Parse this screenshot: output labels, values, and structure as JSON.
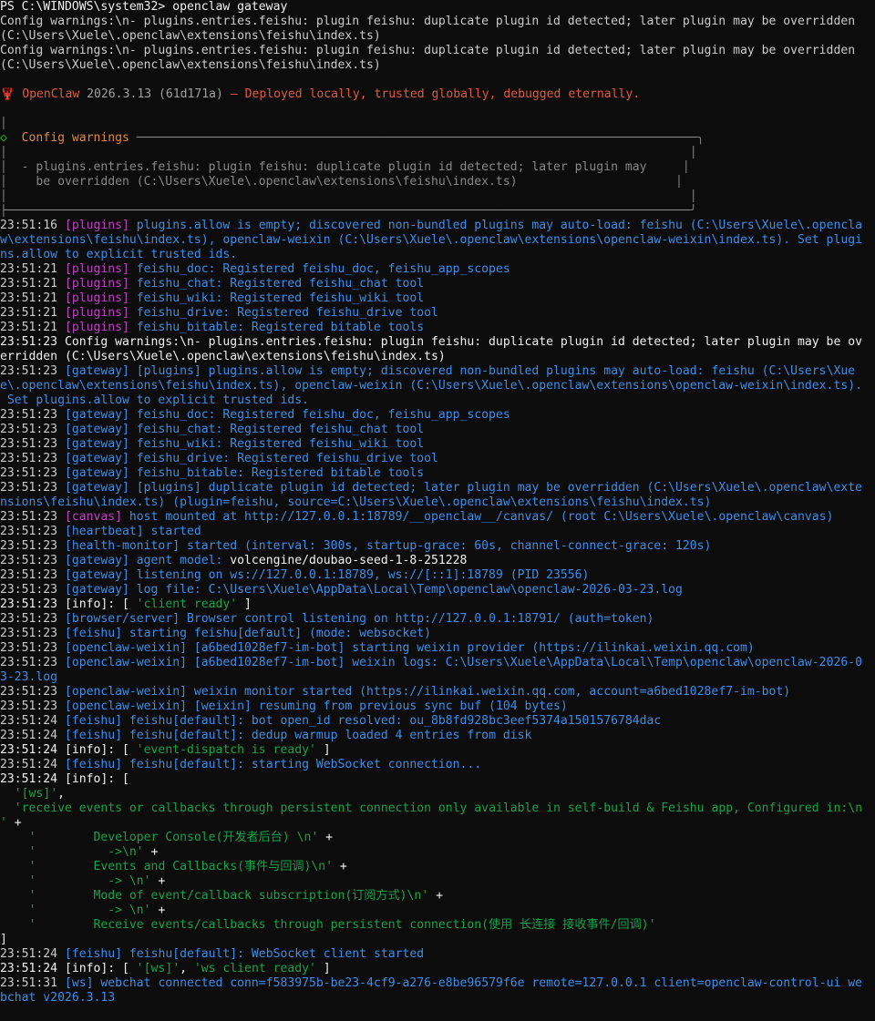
{
  "prompt": {
    "ps": "PS C:\\WINDOWS\\system32> ",
    "command": "openclaw gateway"
  },
  "lines": [
    {
      "segs": [
        {
          "t": "Config warnings:\\n- plugins.entries.feishu: plugin feishu: duplicate plugin id detected; later plugin may be overridden",
          "c": "w"
        }
      ]
    },
    {
      "segs": [
        {
          "t": "(C:\\Users\\Xuele\\.openclaw\\extensions\\feishu\\index.ts)",
          "c": "w"
        }
      ]
    },
    {
      "segs": [
        {
          "t": "Config warnings:\\n- plugins.entries.feishu: plugin feishu: duplicate plugin id detected; later plugin may be overridden",
          "c": "w"
        }
      ]
    },
    {
      "segs": [
        {
          "t": "(C:\\Users\\Xuele\\.openclaw\\extensions\\feishu\\index.ts)",
          "c": "w"
        }
      ]
    },
    {
      "segs": [
        {
          "t": "",
          "c": "w"
        }
      ]
    },
    {
      "segs": [
        {
          "t": "🦞 ",
          "c": "banner-name"
        },
        {
          "t": "OpenClaw",
          "c": "banner-name"
        },
        {
          "t": " 2026.3.13 (61d171a)",
          "c": "banner-ver"
        },
        {
          "t": " — Deployed locally, trusted globally, debugged eternally.",
          "c": "banner-tag"
        }
      ]
    },
    {
      "segs": [
        {
          "t": "",
          "c": "w"
        }
      ]
    },
    {
      "segs": [
        {
          "t": "│",
          "c": "box"
        }
      ]
    },
    {
      "segs": [
        {
          "t": "◇  ",
          "c": "gr"
        },
        {
          "t": "Config warnings",
          "c": "warnhead"
        },
        {
          "t": " ──────────────────────────────────────────────────────────────────────────────╮",
          "c": "box"
        }
      ]
    },
    {
      "segs": [
        {
          "t": "│                                                                                               │",
          "c": "box"
        }
      ]
    },
    {
      "segs": [
        {
          "t": "│  - plugins.entries.feishu: plugin feishu: duplicate plugin id detected; later plugin may     │",
          "c": "box"
        }
      ]
    },
    {
      "segs": [
        {
          "t": "│    be overridden (C:\\Users\\Xuele\\.openclaw\\extensions\\feishu\\index.ts)                      │",
          "c": "box"
        }
      ]
    },
    {
      "segs": [
        {
          "t": "│                                                                                               │",
          "c": "box"
        }
      ]
    },
    {
      "segs": [
        {
          "t": "├───────────────────────────────────────────────────────────────────────────────────────────────╯",
          "c": "box"
        }
      ]
    },
    {
      "segs": [
        {
          "t": "23:51:16 ",
          "c": "ts"
        },
        {
          "t": "[plugins]",
          "c": "tag-pl"
        },
        {
          "t": " plugins.allow is empty; discovered non-bundled plugins may auto-load: feishu (C:\\Users\\Xuele\\.opencla",
          "c": "msg-dim"
        }
      ]
    },
    {
      "segs": [
        {
          "t": "w\\extensions\\feishu\\index.ts), openclaw-weixin (C:\\Users\\Xuele\\.openclaw\\extensions\\openclaw-weixin\\index.ts). Set plugi",
          "c": "msg-dim"
        }
      ]
    },
    {
      "segs": [
        {
          "t": "ns.allow to explicit trusted ids.",
          "c": "msg-dim"
        }
      ]
    },
    {
      "segs": [
        {
          "t": "23:51:21 ",
          "c": "ts"
        },
        {
          "t": "[plugins]",
          "c": "tag-pl"
        },
        {
          "t": " feishu_doc: Registered feishu_doc, feishu_app_scopes",
          "c": "msg-dim"
        }
      ]
    },
    {
      "segs": [
        {
          "t": "23:51:21 ",
          "c": "ts"
        },
        {
          "t": "[plugins]",
          "c": "tag-pl"
        },
        {
          "t": " feishu_chat: Registered feishu_chat tool",
          "c": "msg-dim"
        }
      ]
    },
    {
      "segs": [
        {
          "t": "23:51:21 ",
          "c": "ts"
        },
        {
          "t": "[plugins]",
          "c": "tag-pl"
        },
        {
          "t": " feishu_wiki: Registered feishu_wiki tool",
          "c": "msg-dim"
        }
      ]
    },
    {
      "segs": [
        {
          "t": "23:51:21 ",
          "c": "ts"
        },
        {
          "t": "[plugins]",
          "c": "tag-pl"
        },
        {
          "t": " feishu_drive: Registered feishu_drive tool",
          "c": "msg-dim"
        }
      ]
    },
    {
      "segs": [
        {
          "t": "23:51:21 ",
          "c": "ts"
        },
        {
          "t": "[plugins]",
          "c": "tag-pl"
        },
        {
          "t": " feishu_bitable: Registered bitable tools",
          "c": "msg-dim"
        }
      ]
    },
    {
      "segs": [
        {
          "t": "23:51:23 Config warnings:\\n- plugins.entries.feishu: plugin feishu: duplicate plugin id detected; later plugin may be ov",
          "c": "bw"
        }
      ]
    },
    {
      "segs": [
        {
          "t": "erridden (C:\\Users\\Xuele\\.openclaw\\extensions\\feishu\\index.ts)",
          "c": "bw"
        }
      ]
    },
    {
      "segs": [
        {
          "t": "23:51:23 ",
          "c": "ts"
        },
        {
          "t": "[gateway]",
          "c": "tag-gw"
        },
        {
          "t": " [plugins] plugins.allow is empty; discovered non-bundled plugins may auto-load: feishu (C:\\Users\\Xue",
          "c": "msg-dim"
        }
      ]
    },
    {
      "segs": [
        {
          "t": "e\\.openclaw\\extensions\\feishu\\index.ts), openclaw-weixin (C:\\Users\\Xuele\\.openclaw\\extensions\\openclaw-weixin\\index.ts).",
          "c": "msg-dim"
        }
      ]
    },
    {
      "segs": [
        {
          "t": " Set plugins.allow to explicit trusted ids.",
          "c": "msg-dim"
        }
      ]
    },
    {
      "segs": [
        {
          "t": "23:51:23 ",
          "c": "ts"
        },
        {
          "t": "[gateway]",
          "c": "tag-gw"
        },
        {
          "t": " feishu_doc: Registered feishu_doc, feishu_app_scopes",
          "c": "msg-dim"
        }
      ]
    },
    {
      "segs": [
        {
          "t": "23:51:23 ",
          "c": "ts"
        },
        {
          "t": "[gateway]",
          "c": "tag-gw"
        },
        {
          "t": " feishu_chat: Registered feishu_chat tool",
          "c": "msg-dim"
        }
      ]
    },
    {
      "segs": [
        {
          "t": "23:51:23 ",
          "c": "ts"
        },
        {
          "t": "[gateway]",
          "c": "tag-gw"
        },
        {
          "t": " feishu_wiki: Registered feishu_wiki tool",
          "c": "msg-dim"
        }
      ]
    },
    {
      "segs": [
        {
          "t": "23:51:23 ",
          "c": "ts"
        },
        {
          "t": "[gateway]",
          "c": "tag-gw"
        },
        {
          "t": " feishu_drive: Registered feishu_drive tool",
          "c": "msg-dim"
        }
      ]
    },
    {
      "segs": [
        {
          "t": "23:51:23 ",
          "c": "ts"
        },
        {
          "t": "[gateway]",
          "c": "tag-gw"
        },
        {
          "t": " feishu_bitable: Registered bitable tools",
          "c": "msg-dim"
        }
      ]
    },
    {
      "segs": [
        {
          "t": "23:51:23 ",
          "c": "ts"
        },
        {
          "t": "[gateway]",
          "c": "tag-gw"
        },
        {
          "t": " [plugins] duplicate plugin id detected; later plugin may be overridden (C:\\Users\\Xuele\\.openclaw\\exte",
          "c": "msg-dim"
        }
      ]
    },
    {
      "segs": [
        {
          "t": "nsions\\feishu\\index.ts) (plugin=feishu, source=C:\\Users\\Xuele\\.openclaw\\extensions\\feishu\\index.ts)",
          "c": "msg-dim"
        }
      ]
    },
    {
      "segs": [
        {
          "t": "23:51:23 ",
          "c": "ts"
        },
        {
          "t": "[canvas]",
          "c": "tag-cv"
        },
        {
          "t": " host mounted at http://127.0.0.1:18789/__openclaw__/canvas/ (root C:\\Users\\Xuele\\.openclaw\\canvas)",
          "c": "msg-dim"
        }
      ]
    },
    {
      "segs": [
        {
          "t": "23:51:23 ",
          "c": "ts"
        },
        {
          "t": "[heartbeat]",
          "c": "tag-hb"
        },
        {
          "t": " started",
          "c": "msg-dim"
        }
      ]
    },
    {
      "segs": [
        {
          "t": "23:51:23 ",
          "c": "ts"
        },
        {
          "t": "[health-monitor]",
          "c": "tag-hm"
        },
        {
          "t": " started (interval: 300s, startup-grace: 60s, channel-connect-grace: 120s)",
          "c": "msg-dim"
        }
      ]
    },
    {
      "segs": [
        {
          "t": "23:51:23 ",
          "c": "ts"
        },
        {
          "t": "[gateway]",
          "c": "tag-gw"
        },
        {
          "t": " agent model: ",
          "c": "msg-dim"
        },
        {
          "t": "volcengine/doubao-seed-1-8-251228",
          "c": "bw"
        }
      ]
    },
    {
      "segs": [
        {
          "t": "23:51:23 ",
          "c": "ts"
        },
        {
          "t": "[gateway]",
          "c": "tag-gw"
        },
        {
          "t": " listening on ws://127.0.0.1:18789, ws://[::1]:18789 (PID 23556)",
          "c": "msg-dim"
        }
      ]
    },
    {
      "segs": [
        {
          "t": "23:51:23 ",
          "c": "ts"
        },
        {
          "t": "[gateway]",
          "c": "tag-gw"
        },
        {
          "t": " log file: C:\\Users\\Xuele\\AppData\\Local\\Temp\\openclaw\\openclaw-2026-03-23.log",
          "c": "msg-dim"
        }
      ]
    },
    {
      "segs": [
        {
          "t": "23:51:23 [info]: [ ",
          "c": "bw"
        },
        {
          "t": "'client ready'",
          "c": "str"
        },
        {
          "t": " ]",
          "c": "bw"
        }
      ]
    },
    {
      "segs": [
        {
          "t": "23:51:23 ",
          "c": "ts"
        },
        {
          "t": "[browser/server]",
          "c": "tag-bs"
        },
        {
          "t": " Browser control listening on http://127.0.0.1:18791/ (auth=token)",
          "c": "msg-dim"
        }
      ]
    },
    {
      "segs": [
        {
          "t": "23:51:23 ",
          "c": "ts"
        },
        {
          "t": "[feishu]",
          "c": "tag-fs"
        },
        {
          "t": " starting feishu[default] (mode: websocket)",
          "c": "msg-dim"
        }
      ]
    },
    {
      "segs": [
        {
          "t": "23:51:23 ",
          "c": "ts"
        },
        {
          "t": "[openclaw-weixin]",
          "c": "tag-ow"
        },
        {
          "t": " [a6bed1028ef7-im-bot] starting weixin provider (https://ilinkai.weixin.qq.com)",
          "c": "msg-dim"
        }
      ]
    },
    {
      "segs": [
        {
          "t": "23:51:23 ",
          "c": "ts"
        },
        {
          "t": "[openclaw-weixin]",
          "c": "tag-ow"
        },
        {
          "t": " [a6bed1028ef7-im-bot] weixin logs: C:\\Users\\Xuele\\AppData\\Local\\Temp\\openclaw\\openclaw-2026-0",
          "c": "msg-dim"
        }
      ]
    },
    {
      "segs": [
        {
          "t": "3-23.log",
          "c": "msg-dim"
        }
      ]
    },
    {
      "segs": [
        {
          "t": "23:51:23 ",
          "c": "ts"
        },
        {
          "t": "[openclaw-weixin]",
          "c": "tag-ow"
        },
        {
          "t": " weixin monitor started (https://ilinkai.weixin.qq.com, account=a6bed1028ef7-im-bot)",
          "c": "msg-dim"
        }
      ]
    },
    {
      "segs": [
        {
          "t": "23:51:23 ",
          "c": "ts"
        },
        {
          "t": "[openclaw-weixin]",
          "c": "tag-ow"
        },
        {
          "t": " [weixin] resuming from previous sync buf (104 bytes)",
          "c": "msg-dim"
        }
      ]
    },
    {
      "segs": [
        {
          "t": "23:51:24 ",
          "c": "ts"
        },
        {
          "t": "[feishu]",
          "c": "tag-fs"
        },
        {
          "t": " feishu[default]: bot open_id resolved: ou_8b8fd928bc3eef5374a1501576784dac",
          "c": "msg-dim"
        }
      ]
    },
    {
      "segs": [
        {
          "t": "23:51:24 ",
          "c": "ts"
        },
        {
          "t": "[feishu]",
          "c": "tag-fs"
        },
        {
          "t": " feishu[default]: dedup warmup loaded 4 entries from disk",
          "c": "msg-dim"
        }
      ]
    },
    {
      "segs": [
        {
          "t": "23:51:24 [info]: [ ",
          "c": "bw"
        },
        {
          "t": "'event-dispatch is ready'",
          "c": "str"
        },
        {
          "t": " ]",
          "c": "bw"
        }
      ]
    },
    {
      "segs": [
        {
          "t": "23:51:24 ",
          "c": "ts"
        },
        {
          "t": "[feishu]",
          "c": "tag-fs"
        },
        {
          "t": " feishu[default]: starting WebSocket connection...",
          "c": "msg-dim"
        }
      ]
    },
    {
      "segs": [
        {
          "t": "23:51:24 [info]: [",
          "c": "bw"
        }
      ]
    },
    {
      "segs": [
        {
          "t": "  ",
          "c": "bw"
        },
        {
          "t": "'[ws]'",
          "c": "str"
        },
        {
          "t": ",",
          "c": "bw"
        }
      ]
    },
    {
      "segs": [
        {
          "t": "  ",
          "c": "bw"
        },
        {
          "t": "'receive events or callbacks through persistent connection only available in self-build & Feishu app, Configured in:\\n",
          "c": "str"
        }
      ]
    },
    {
      "segs": [
        {
          "t": "' ",
          "c": "str"
        },
        {
          "t": "+",
          "c": "bw"
        }
      ]
    },
    {
      "segs": [
        {
          "t": "    ",
          "c": "bw"
        },
        {
          "t": "'        Developer Console(开发者后台) \\n'",
          "c": "str"
        },
        {
          "t": " +",
          "c": "bw"
        }
      ]
    },
    {
      "segs": [
        {
          "t": "    ",
          "c": "bw"
        },
        {
          "t": "'          ->\\n'",
          "c": "str"
        },
        {
          "t": " +",
          "c": "bw"
        }
      ]
    },
    {
      "segs": [
        {
          "t": "    ",
          "c": "bw"
        },
        {
          "t": "'        Events and Callbacks(事件与回调)\\n'",
          "c": "str"
        },
        {
          "t": " +",
          "c": "bw"
        }
      ]
    },
    {
      "segs": [
        {
          "t": "    ",
          "c": "bw"
        },
        {
          "t": "'          -> \\n'",
          "c": "str"
        },
        {
          "t": " +",
          "c": "bw"
        }
      ]
    },
    {
      "segs": [
        {
          "t": "    ",
          "c": "bw"
        },
        {
          "t": "'        Mode of event/callback subscription(订阅方式)\\n'",
          "c": "str"
        },
        {
          "t": " +",
          "c": "bw"
        }
      ]
    },
    {
      "segs": [
        {
          "t": "    ",
          "c": "bw"
        },
        {
          "t": "'          -> \\n'",
          "c": "str"
        },
        {
          "t": " +",
          "c": "bw"
        }
      ]
    },
    {
      "segs": [
        {
          "t": "    ",
          "c": "bw"
        },
        {
          "t": "'        Receive events/callbacks through persistent connection(使用 长连接 接收事件/回调)'",
          "c": "str"
        }
      ]
    },
    {
      "segs": [
        {
          "t": "]",
          "c": "bw"
        }
      ]
    },
    {
      "segs": [
        {
          "t": "23:51:24 ",
          "c": "ts"
        },
        {
          "t": "[feishu]",
          "c": "tag-fs"
        },
        {
          "t": " feishu[default]: WebSocket client started",
          "c": "msg-dim"
        }
      ]
    },
    {
      "segs": [
        {
          "t": "23:51:24 [info]: [ ",
          "c": "bw"
        },
        {
          "t": "'[ws]'",
          "c": "str"
        },
        {
          "t": ", ",
          "c": "bw"
        },
        {
          "t": "'ws client ready'",
          "c": "str"
        },
        {
          "t": " ]",
          "c": "bw"
        }
      ]
    },
    {
      "segs": [
        {
          "t": "23:51:31 ",
          "c": "ts"
        },
        {
          "t": "[ws]",
          "c": "tag-ws"
        },
        {
          "t": " webchat connected conn=f583975b-be23-4cf9-a276-e8be96579f6e remote=127.0.0.1 client=openclaw-control-ui we",
          "c": "msg-dim"
        }
      ]
    },
    {
      "segs": [
        {
          "t": "bchat v2026.3.13",
          "c": "msg-dim"
        }
      ]
    }
  ]
}
